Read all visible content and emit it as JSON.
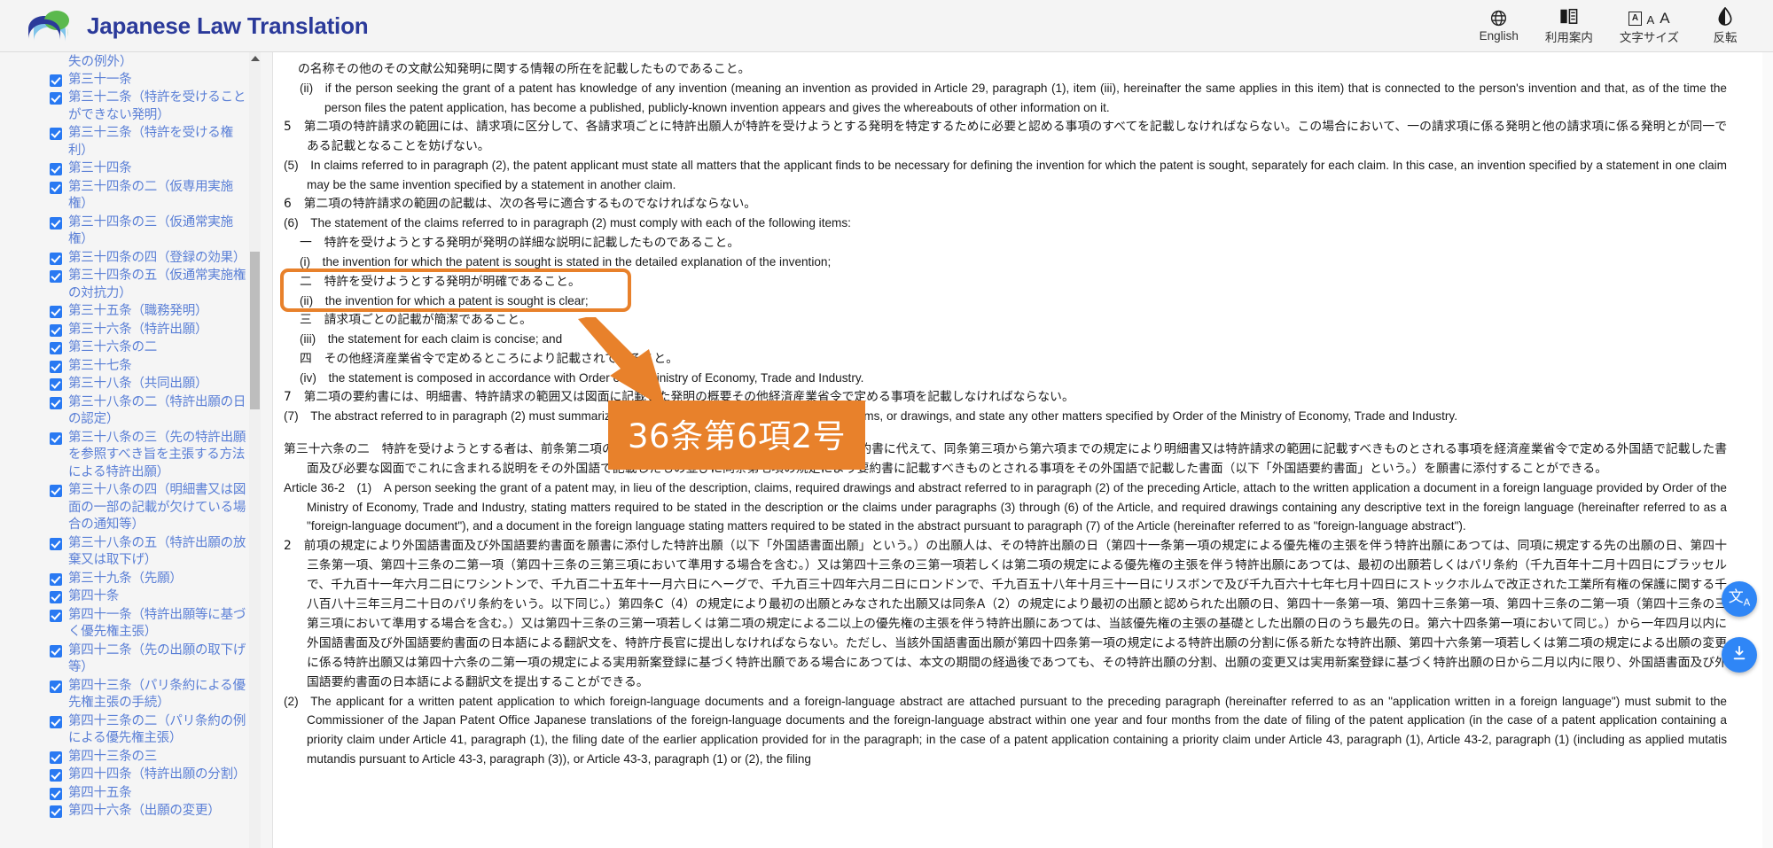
{
  "header": {
    "brand_title": "Japanese Law Translation",
    "tools": [
      {
        "icon": "globe-icon",
        "label": "English"
      },
      {
        "icon": "book-icon",
        "label": "利用案内"
      },
      {
        "icon": "font-size-icon",
        "label": "文字サイズ"
      },
      {
        "icon": "contrast-icon",
        "label": "反転"
      }
    ],
    "accent_color": "#2b3a9a",
    "background": "#f4f4f4"
  },
  "sidebar": {
    "orphan_top": "失の例外）",
    "items": [
      {
        "label": "第三十一条",
        "checked": true
      },
      {
        "label": "第三十二条（特許を受けることができない発明）",
        "checked": true
      },
      {
        "label": "第三十三条（特許を受ける権利）",
        "checked": true
      },
      {
        "label": "第三十四条",
        "checked": true
      },
      {
        "label": "第三十四条の二（仮専用実施権）",
        "checked": true
      },
      {
        "label": "第三十四条の三（仮通常実施権）",
        "checked": true
      },
      {
        "label": "第三十四条の四（登録の効果）",
        "checked": true
      },
      {
        "label": "第三十四条の五（仮通常実施権の対抗力）",
        "checked": true
      },
      {
        "label": "第三十五条（職務発明）",
        "checked": true
      },
      {
        "label": "第三十六条（特許出願）",
        "checked": true
      },
      {
        "label": "第三十六条の二",
        "checked": true
      },
      {
        "label": "第三十七条",
        "checked": true
      },
      {
        "label": "第三十八条（共同出願）",
        "checked": true
      },
      {
        "label": "第三十八条の二（特許出願の日の認定）",
        "checked": true
      },
      {
        "label": "第三十八条の三（先の特許出願を参照すべき旨を主張する方法による特許出願）",
        "checked": true
      },
      {
        "label": "第三十八条の四（明細書又は図面の一部の記載が欠けている場合の通知等）",
        "checked": true
      },
      {
        "label": "第三十八条の五（特許出願の放棄又は取下げ）",
        "checked": true
      },
      {
        "label": "第三十九条（先願）",
        "checked": true
      },
      {
        "label": "第四十条",
        "checked": true
      },
      {
        "label": "第四十一条（特許出願等に基づく優先権主張）",
        "checked": true
      },
      {
        "label": "第四十二条（先の出願の取下げ等）",
        "checked": true
      },
      {
        "label": "第四十三条（パリ条約による優先権主張の手続）",
        "checked": true
      },
      {
        "label": "第四十三条の二（パリ条約の例による優先権主張）",
        "checked": true
      },
      {
        "label": "第四十三条の三",
        "checked": true
      },
      {
        "label": "第四十四条（特許出願の分割）",
        "checked": true
      },
      {
        "label": "第四十五条",
        "checked": true
      },
      {
        "label": "第四十六条（出願の変更）",
        "checked": true
      }
    ],
    "checkbox_color": "#2979f2",
    "link_color": "#5a7fd6"
  },
  "document": {
    "paragraphs": [
      {
        "id": "p-ja-cont-ii",
        "lang": "ja",
        "style": "ind-hang-2",
        "text": "の名称その他のその文献公知発明に関する情報の所在を記載したものであること。"
      },
      {
        "id": "p-en-item-ii",
        "lang": "en",
        "style": "ind-hang-item",
        "text": "(ii) if the person seeking the grant of a patent has knowledge of any invention (meaning an invention as provided in Article 29, paragraph (1), item (iii), hereinafter the same applies in this item) that is connected to the person's invention and that, as of the time the person files the patent application, has become a published, publicly-known invention appears and gives the whereabouts of other information on it."
      },
      {
        "id": "p-ja-5",
        "lang": "ja",
        "style": "ind-hang-1",
        "text": "5　第二項の特許請求の範囲には、請求項に区分して、各請求項ごとに特許出願人が特許を受けようとする発明を特定するために必要と認める事項のすべてを記載しなければならない。この場合において、一の請求項に係る発明と他の請求項に係る発明とが同一である記載となることを妨げない。"
      },
      {
        "id": "p-en-5",
        "lang": "en",
        "style": "ind-hang-1",
        "text": "(5) In claims referred to in paragraph (2), the patent applicant must state all matters that the applicant finds to be necessary for defining the invention for which the patent is sought, separately for each claim. In this case, an invention specified by a statement in one claim may be the same invention specified by a statement in another claim."
      },
      {
        "id": "p-ja-6",
        "lang": "ja",
        "style": "ind-hang-1",
        "text": "6　第二項の特許請求の範囲の記載は、次の各号に適合するものでなければならない。"
      },
      {
        "id": "p-en-6",
        "lang": "en",
        "style": "ind-hang-1",
        "text": "(6) The statement of the claims referred to in paragraph (2) must comply with each of the following items:"
      },
      {
        "id": "p-ja-item-1",
        "lang": "ja",
        "style": "ind-hang-item",
        "text": "一　特許を受けようとする発明が発明の詳細な説明に記載したものであること。"
      },
      {
        "id": "p-en-item-i",
        "lang": "en",
        "style": "ind-hang-item",
        "text": "(i) the invention for which the patent is sought is stated in the detailed explanation of the invention;"
      },
      {
        "id": "p-ja-item-2",
        "lang": "ja",
        "style": "ind-hang-item",
        "highlighted": true,
        "text": "二　特許を受けようとする発明が明確であること。"
      },
      {
        "id": "p-en-item-ii-2",
        "lang": "en",
        "style": "ind-hang-item",
        "highlighted": true,
        "text": "(ii) the invention for which a patent is sought is clear;"
      },
      {
        "id": "p-ja-item-3",
        "lang": "ja",
        "style": "ind-hang-item",
        "text": "三　請求項ごとの記載が簡潔であること。"
      },
      {
        "id": "p-en-item-iii",
        "lang": "en",
        "style": "ind-hang-item",
        "text": "(iii) the statement for each claim is concise; and"
      },
      {
        "id": "p-ja-item-4",
        "lang": "ja",
        "style": "ind-hang-item",
        "text": "四　その他経済産業省令で定めるところにより記載されていること。"
      },
      {
        "id": "p-en-item-iv",
        "lang": "en",
        "style": "ind-hang-item",
        "text": "(iv) the statement is composed in accordance with Order of the Ministry of Economy, Trade and Industry."
      },
      {
        "id": "p-ja-7",
        "lang": "ja",
        "style": "ind-hang-1",
        "text": "7　第二項の要約書には、明細書、特許請求の範囲又は図面に記載した発明の概要その他経済産業省令で定める事項を記載しなければならない。"
      },
      {
        "id": "p-en-7",
        "lang": "en",
        "style": "ind-hang-1",
        "text": "(7) The abstract referred to in paragraph (2) must summarize the invention described in the description, claims, or drawings, and state any other matters specified by Order of the Ministry of Economy, Trade and Industry."
      },
      {
        "id": "p-ja-36-2",
        "lang": "ja",
        "style": "ind-art",
        "spaced": true,
        "text": "第三十六条の二　特許を受けようとする者は、前条第二項の明細書、特許請求の範囲、必要な図面及び要約書に代えて、同条第三項から第六項までの規定により明細書又は特許請求の範囲に記載すべきものとされる事項を経済産業省令で定める外国語で記載した書面及び必要な図面でこれに含まれる説明をその外国語で記載したもの並びに同条第七項の規定により要約書に記載すべきものとされる事項をその外国語で記載した書面（以下「外国語要約書面」という。）を願書に添付することができる。"
      },
      {
        "id": "p-en-36-2-1",
        "lang": "en",
        "style": "ind-art",
        "text": "Article 36-2 (1) A person seeking the grant of a patent may, in lieu of the description, claims, required drawings and abstract referred to in paragraph (2) of the preceding Article, attach to the written application a document in a foreign language provided by Order of the Ministry of Economy, Trade and Industry, stating matters required to be stated in the description or the claims under paragraphs (3) through (6) of the Article, and required drawings containing any descriptive text in the foreign language (hereinafter referred to as a \"foreign-language document\"), and a document in the foreign language stating matters required to be stated in the abstract pursuant to paragraph (7) of the Article (hereinafter referred to as \"foreign-language abstract\")."
      },
      {
        "id": "p-ja-36-2-2",
        "lang": "ja",
        "style": "ind-hang-1",
        "text": "2　前項の規定により外国語書面及び外国語要約書面を願書に添付した特許出願（以下「外国語書面出願」という。）の出願人は、その特許出願の日（第四十一条第一項の規定による優先権の主張を伴う特許出願にあつては、同項に規定する先の出願の日、第四十三条第一項、第四十三条の二第一項（第四十三条の三第三項において準用する場合を含む。）又は第四十三条の三第一項若しくは第二項の規定による優先権の主張を伴う特許出願にあつては、最初の出願若しくはパリ条約（千九百年十二月十四日にブラッセルで、千九百十一年六月二日にワシントンで、千九百二十五年十一月六日にヘーグで、千九百三十四年六月二日にロンドンで、千九百五十八年十月三十一日にリスボンで及び千九百六十七年七月十四日にストックホルムで改正された工業所有権の保護に関する千八百八十三年三月二十日のパリ条約をいう。以下同じ。）第四条C（4）の規定により最初の出願とみなされた出願又は同条A（2）の規定により最初の出願と認められた出願の日、第四十一条第一項、第四十三条第一項、第四十三条の二第一項（第四十三条の三第三項において準用する場合を含む。）又は第四十三条の三第一項若しくは第二項の規定による二以上の優先権の主張を伴う特許出願にあつては、当該優先権の主張の基礎とした出願の日のうち最先の日。第六十四条第一項において同じ。）から一年四月以内に外国語書面及び外国語要約書面の日本語による翻訳文を、特許庁長官に提出しなければならない。ただし、当該外国語書面出願が第四十四条第一項の規定による特許出願の分割に係る新たな特許出願、第四十六条第一項若しくは第二項の規定による出願の変更に係る特許出願又は第四十六条の二第一項の規定による実用新案登録に基づく特許出願である場合にあつては、本文の期間の経過後であつても、その特許出願の分割、出願の変更又は実用新案登録に基づく特許出願の日から二月以内に限り、外国語書面及び外国語要約書面の日本語による翻訳文を提出することができる。"
      },
      {
        "id": "p-en-36-2-2",
        "lang": "en",
        "style": "ind-hang-1",
        "text": "(2) The applicant for a written patent application to which foreign-language documents and a foreign-language abstract are attached pursuant to the preceding paragraph (hereinafter referred to as an \"application written in a foreign language\") must submit to the Commissioner of the Japan Patent Office Japanese translations of the foreign-language documents and the foreign-language abstract within one year and four months from the date of filing of the patent application (in the case of a patent application containing a priority claim under Article 41, paragraph (1), the filing date of the earlier application provided for in the paragraph; in the case of a patent application containing a priority claim under Article 43, paragraph (1), Article 43-2, paragraph (1) (including as applied mutatis mutandis pursuant to Article 43-3, paragraph (3)), or Article 43-3, paragraph (1) or (2), the filing"
      }
    ]
  },
  "annotation": {
    "callout_text": "36条第6項2号",
    "color": "#e8812b",
    "highlight_target": "二 特許を受けようとする発明が明確であること。 / (ii) the invention for which a patent is sought is clear;"
  },
  "fabs": [
    {
      "name": "translate-fab",
      "glyph": "文",
      "sub": "A"
    },
    {
      "name": "download-fab",
      "glyph": "↓"
    }
  ]
}
